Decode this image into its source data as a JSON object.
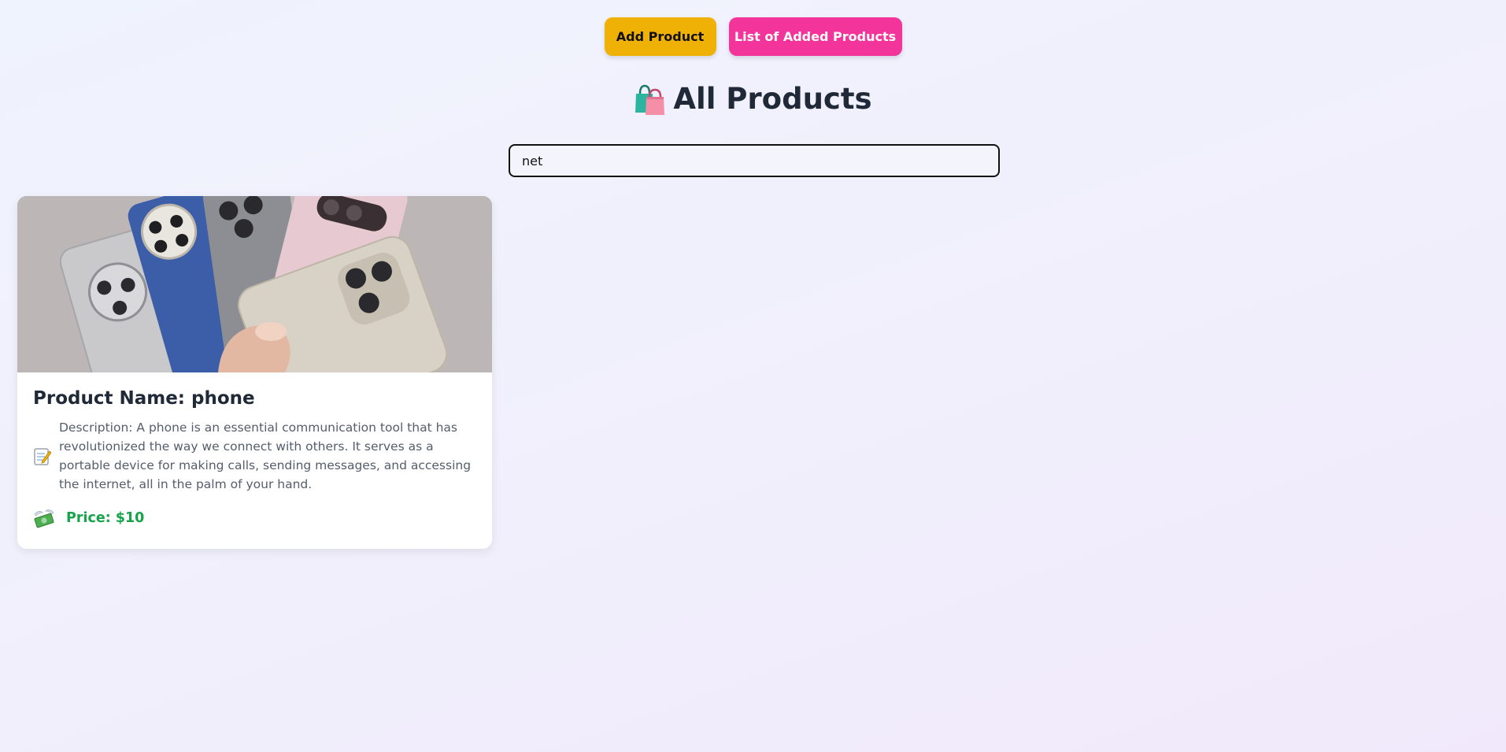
{
  "toolbar": {
    "add_label": "Add Product",
    "list_label": "List of Added Products"
  },
  "header": {
    "title": "All Products",
    "icon": "shopping-bags-icon"
  },
  "search": {
    "value": "net",
    "placeholder": ""
  },
  "products": [
    {
      "name_label": "Product Name: phone",
      "description_label": "Description: A phone is an essential communication tool that has revolutionized the way we connect with others. It serves as a portable device for making calls, sending messages, and accessing the internet, all in the palm of your hand.",
      "price_label": "Price: $10",
      "image": "phone-photo",
      "description_icon": "memo-icon",
      "price_icon": "money-with-wings-icon"
    }
  ],
  "colors": {
    "add_button": "#f0b106",
    "list_button": "#f3349a",
    "price": "#16a34a"
  }
}
